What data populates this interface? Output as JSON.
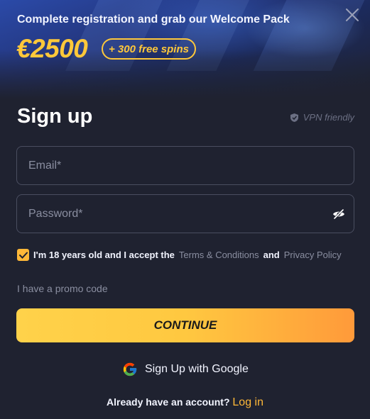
{
  "banner": {
    "headline": "Complete registration and grab our Welcome Pack",
    "amount": "€2500",
    "spins_badge": "+ 300 free spins"
  },
  "form": {
    "title": "Sign up",
    "vpn_label": "VPN friendly",
    "email_placeholder": "Email*",
    "password_placeholder": "Password*",
    "terms": {
      "checked": true,
      "prefix": "I'm 18 years old and I accept the",
      "terms_link": "Terms & Conditions",
      "and": "and",
      "privacy_link": "Privacy Policy"
    },
    "promo_label": "I have a promo code",
    "continue_label": "CONTINUE",
    "google_label": "Sign Up with Google",
    "login_prompt": "Already have an account?",
    "login_link": "Log in"
  },
  "colors": {
    "accent": "#ffc83a",
    "background": "#1f2230",
    "muted": "#8a8ea0"
  },
  "icons": [
    "close-icon",
    "shield-icon",
    "eye-slash-icon",
    "check-icon",
    "google-icon"
  ]
}
